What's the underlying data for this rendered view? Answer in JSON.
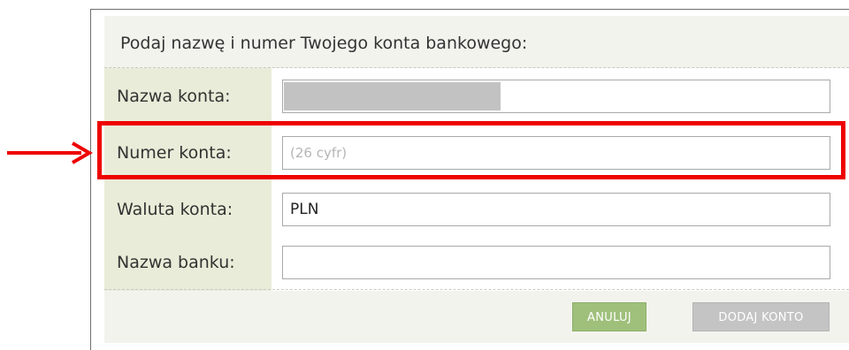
{
  "form": {
    "title": "Podaj nazwę i numer Twojego konta bankowego:"
  },
  "fields": {
    "account_name": {
      "label": "Nazwa konta:",
      "value": ""
    },
    "account_number": {
      "label": "Numer konta:",
      "value": "",
      "placeholder": "(26 cyfr)"
    },
    "currency": {
      "label": "Waluta konta:",
      "value": "PLN"
    },
    "bank_name": {
      "label": "Nazwa banku:",
      "value": ""
    }
  },
  "buttons": {
    "cancel": "ANULUJ",
    "add_account": "DODAJ KONTO"
  },
  "colors": {
    "highlight": "#ee0000",
    "label_bg": "#e9ecd8",
    "cancel_button": "#9fc07b",
    "add_button_disabled": "#c4c4c4"
  }
}
